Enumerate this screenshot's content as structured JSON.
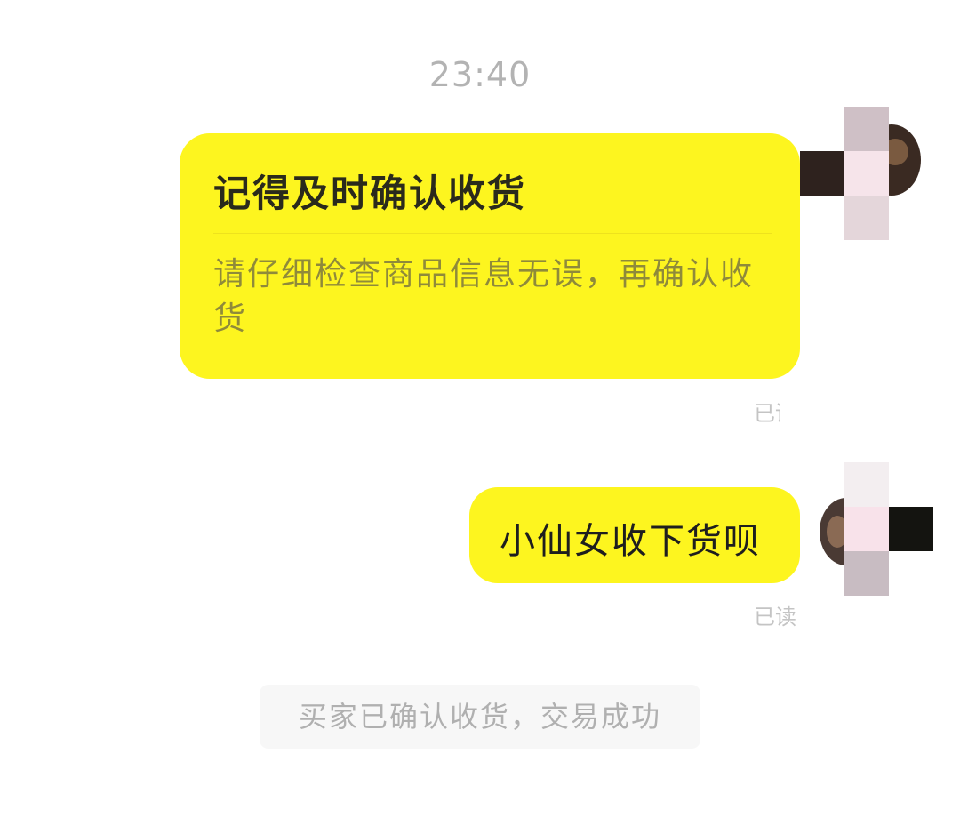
{
  "chat": {
    "timestamp": "23:40",
    "card_message": {
      "title": "记得及时确认收货",
      "body": "请仔细检查商品信息无误，再确认收货",
      "read_status": "已读"
    },
    "text_message": {
      "text": "小仙女收下货呗",
      "read_status": "已读"
    },
    "system_notice": "买家已确认收货，交易成功"
  },
  "colors": {
    "bubble": "#fdf51f",
    "timestamp": "#b3b3b3",
    "read_mark": "#c4c4c4",
    "notice_bg": "#f7f7f7"
  }
}
